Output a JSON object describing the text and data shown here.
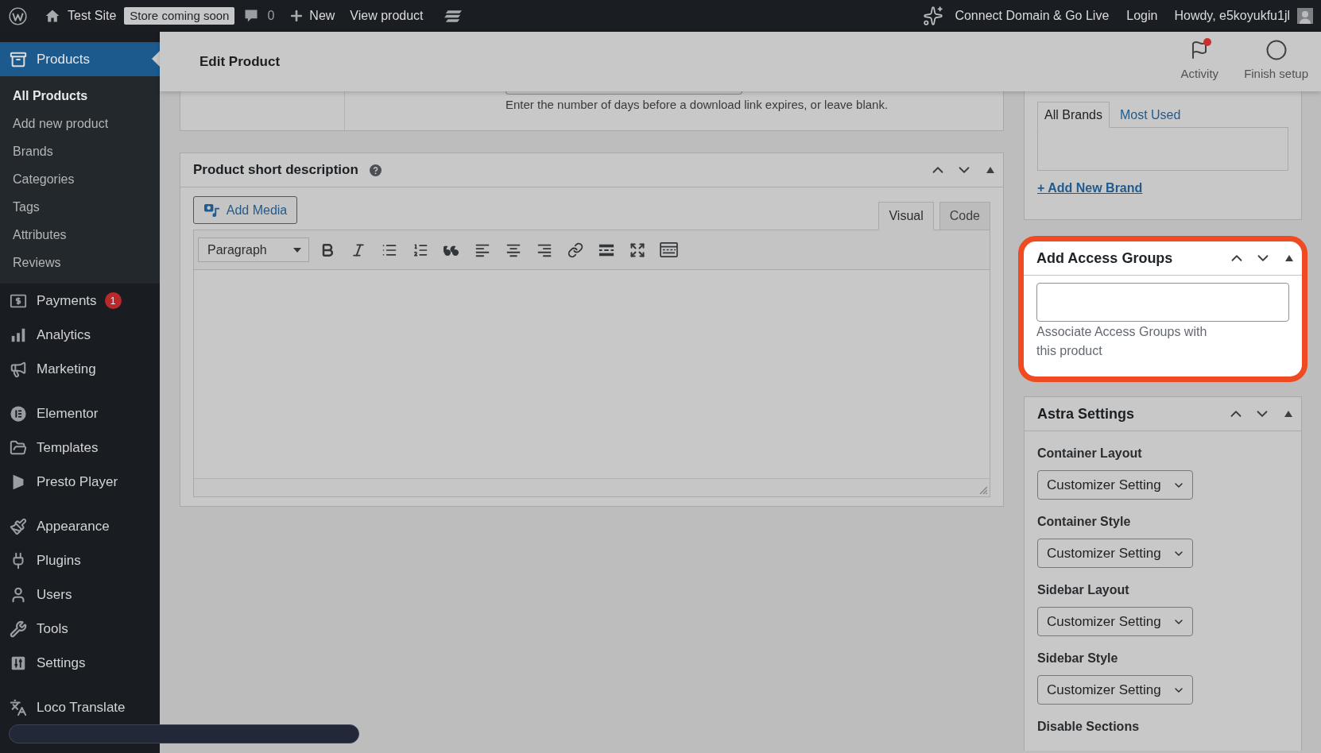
{
  "admin_bar": {
    "site_name": "Test Site",
    "store_notice": "Store coming soon",
    "comment_count": "0",
    "new_label": "New",
    "view_link": "View product",
    "connect_link": "Connect Domain & Go Live",
    "login_link": "Login",
    "greeting": "Howdy, e5koyukfu1jl"
  },
  "sidebar": {
    "groups": [
      {
        "items": [
          {
            "label": "Products",
            "selected": true,
            "children": [
              {
                "label": "All Products",
                "selected": true
              },
              {
                "label": "Add new product",
                "selected": false
              },
              {
                "label": "Brands",
                "selected": false
              },
              {
                "label": "Categories",
                "selected": false
              },
              {
                "label": "Tags",
                "selected": false
              },
              {
                "label": "Attributes",
                "selected": false
              },
              {
                "label": "Reviews",
                "selected": false
              }
            ]
          },
          {
            "label": "Payments",
            "selected": false,
            "badge": "1"
          },
          {
            "label": "Analytics",
            "selected": false
          },
          {
            "label": "Marketing",
            "selected": false
          }
        ]
      },
      {
        "items": [
          {
            "label": "Elementor",
            "selected": false
          },
          {
            "label": "Templates",
            "selected": false
          },
          {
            "label": "Presto Player",
            "selected": false
          }
        ]
      },
      {
        "items": [
          {
            "label": "Appearance",
            "selected": false
          },
          {
            "label": "Plugins",
            "selected": false
          },
          {
            "label": "Users",
            "selected": false
          },
          {
            "label": "Tools",
            "selected": false
          },
          {
            "label": "Settings",
            "selected": false
          }
        ]
      },
      {
        "items": [
          {
            "label": "Loco Translate",
            "selected": false
          }
        ]
      }
    ]
  },
  "header": {
    "title": "Edit Product",
    "actions": [
      {
        "label": "Activity",
        "notification": true
      },
      {
        "label": "Finish setup",
        "notification": false
      }
    ]
  },
  "downloads": {
    "expiry_help": "Enter the number of days before a download link expires, or leave blank."
  },
  "short_description": {
    "title": "Product short description",
    "add_media": "Add Media",
    "editor_tabs": [
      {
        "label": "Visual",
        "selected": true
      },
      {
        "label": "Code",
        "selected": false
      }
    ],
    "block_format": "Paragraph"
  },
  "brands": {
    "tabs": [
      {
        "label": "All Brands",
        "selected": true
      },
      {
        "label": "Most Used",
        "selected": false
      }
    ],
    "add_link": "+ Add New Brand"
  },
  "access_groups": {
    "title": "Add Access Groups",
    "highlighted": true,
    "description": "Associate Access Groups with this product"
  },
  "astra": {
    "title": "Astra Settings",
    "fields": [
      {
        "label": "Container Layout",
        "value": "Customizer Setting"
      },
      {
        "label": "Container Style",
        "value": "Customizer Setting"
      },
      {
        "label": "Sidebar Layout",
        "value": "Customizer Setting"
      },
      {
        "label": "Sidebar Style",
        "value": "Customizer Setting"
      }
    ],
    "sections_heading": "Disable Sections"
  }
}
